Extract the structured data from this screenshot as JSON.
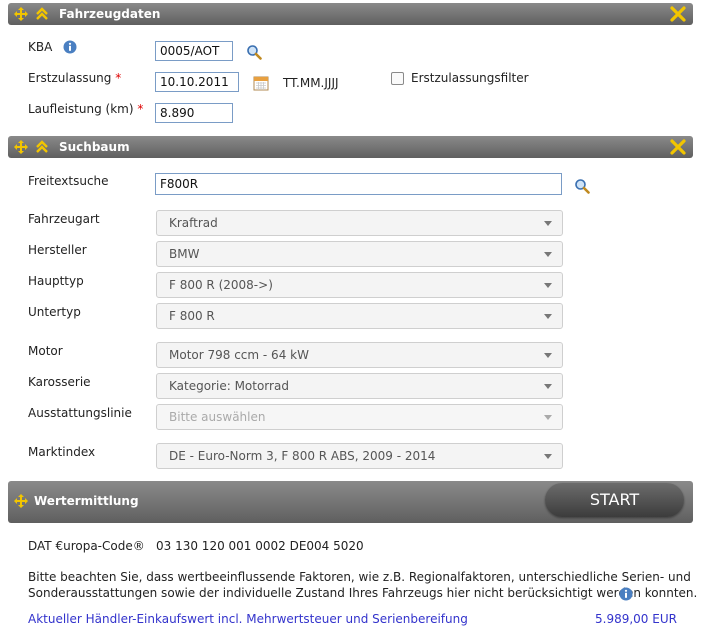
{
  "sections": {
    "fahrzeugdaten": {
      "title": "Fahrzeugdaten"
    },
    "suchbaum": {
      "title": "Suchbaum"
    },
    "wertermittlung": {
      "title": "Wertermittlung",
      "start_label": "START"
    }
  },
  "fahrzeugdaten": {
    "kba_label": "KBA",
    "kba_value": "0005/AOT",
    "erstzulassung_label": "Erstzulassung",
    "erstzulassung_value": "10.10.2011",
    "date_format": "TT.MM.JJJJ",
    "filter_label": "Erstzulassungsfilter",
    "filter_checked": false,
    "laufleistung_label": "Laufleistung (km)",
    "laufleistung_value": "8.890",
    "required_mark": "*"
  },
  "suchbaum": {
    "freitext_label": "Freitextsuche",
    "freitext_value": "F800R",
    "fields": [
      {
        "label": "Fahrzeugart",
        "value": "Kraftrad"
      },
      {
        "label": "Hersteller",
        "value": "BMW"
      },
      {
        "label": "Haupttyp",
        "value": "F 800 R (2008->)"
      },
      {
        "label": "Untertyp",
        "value": "F 800 R"
      },
      {
        "label": "Motor",
        "value": "Motor 798 ccm - 64 kW"
      },
      {
        "label": "Karosserie",
        "value": "Kategorie: Motorrad"
      },
      {
        "label": "Ausstattungslinie",
        "value": "Bitte auswählen"
      },
      {
        "label": "Marktindex",
        "value": "DE - Euro-Norm 3, F 800 R ABS, 2009 - 2014"
      }
    ]
  },
  "result": {
    "dat_label": "DAT €uropa-Code®",
    "dat_value": "03 130 120 001 0002 DE004 5020",
    "notice_line1": "Bitte beachten Sie, dass wertbeeinflussende Faktoren, wie z.B. Regionalfaktoren, unterschiedliche Serien- und",
    "notice_line2": "Sonderausstattungen sowie der individuelle Zustand Ihres Fahrzeugs hier nicht berücksichtigt werden konnten.",
    "value_label": "Aktueller Händler-Einkaufswert incl. Mehrwertsteuer und Serienbereifung",
    "value_amount": "5.989,00 EUR"
  },
  "colors": {
    "header": "#6f6f6f",
    "accent_yellow": "#f2c500",
    "link": "#3333cc",
    "required": "#dd0000"
  }
}
